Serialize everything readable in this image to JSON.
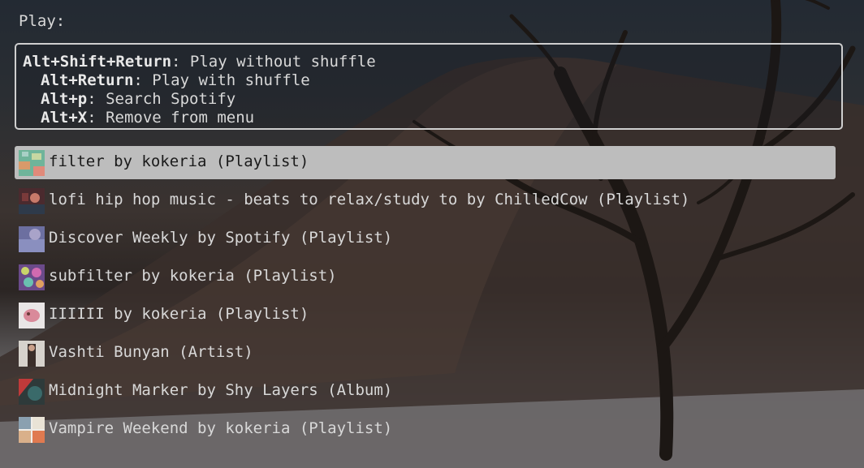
{
  "prompt": "Play:",
  "help": [
    {
      "key": "Alt+Shift+Return",
      "desc": ": Play without shuffle"
    },
    {
      "key": "Alt+Return",
      "desc": ": Play with shuffle"
    },
    {
      "key": "Alt+p",
      "desc": ": Search Spotify"
    },
    {
      "key": "Alt+X",
      "desc": ": Remove from menu"
    }
  ],
  "items": [
    {
      "label": "filter by kokeria (Playlist)",
      "selected": true
    },
    {
      "label": "lofi hip hop music - beats to relax/study to by ChilledCow (Playlist)"
    },
    {
      "label": "Discover Weekly by Spotify (Playlist)"
    },
    {
      "label": "subfilter by kokeria (Playlist)"
    },
    {
      "label": "IIIIII by kokeria (Playlist)"
    },
    {
      "label": "Vashti Bunyan (Artist)"
    },
    {
      "label": "Midnight Marker by Shy Layers (Album)"
    },
    {
      "label": "Vampire Weekend by kokeria (Playlist)"
    }
  ],
  "colors": {
    "selected_bg": "#bdbdbd",
    "text": "#d8d8d8",
    "border": "#cfcfcf"
  }
}
